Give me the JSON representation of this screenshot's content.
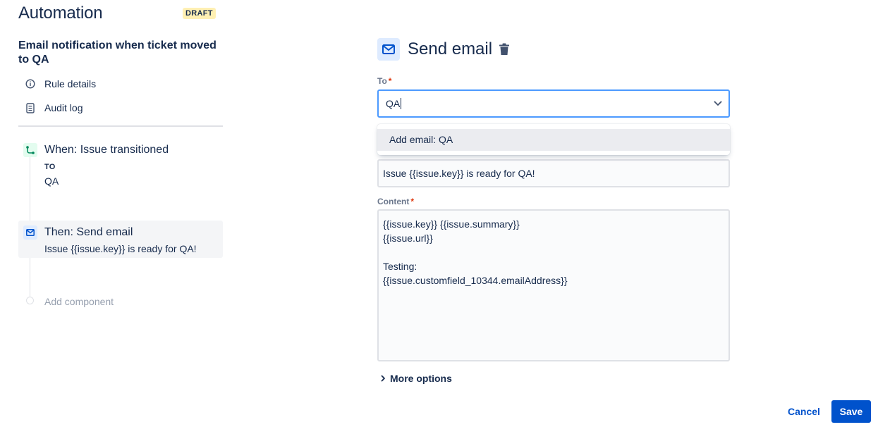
{
  "app": {
    "title": "Automation",
    "status_badge": "DRAFT"
  },
  "rule": {
    "name": "Email notification when ticket moved to QA",
    "nav": [
      {
        "label": "Rule details",
        "icon": "info-icon"
      },
      {
        "label": "Audit log",
        "icon": "document-icon"
      }
    ]
  },
  "flow": {
    "trigger": {
      "title": "When: Issue transitioned",
      "sub_label": "TO",
      "sub_value": "QA",
      "icon": "transition-icon"
    },
    "action": {
      "title": "Then: Send email",
      "subtitle": "Issue {{issue.key}} is ready for QA!",
      "icon": "mail-icon"
    },
    "add_component_label": "Add component"
  },
  "editor": {
    "title": "Send email",
    "icon": "mail-icon",
    "to_label": "To",
    "to_value": "QA",
    "dropdown_option": "Add email: QA",
    "subject_value": "Issue {{issue.key}} is ready for QA!",
    "content_label": "Content",
    "content_value": "{{issue.key}} {{issue.summary}}\n{{issue.url}}\n\nTesting:\n{{issue.customfield_10344.emailAddress}}",
    "more_options_label": "More options",
    "required_mark": "*"
  },
  "footer": {
    "cancel_label": "Cancel",
    "save_label": "Save"
  },
  "colors": {
    "primary": "#0052cc",
    "focus_border": "#4c9aff",
    "draft_badge_bg": "#fff0b3",
    "trigger_bg": "#e3fcef",
    "action_bg": "#deebff",
    "required": "#de350b"
  }
}
